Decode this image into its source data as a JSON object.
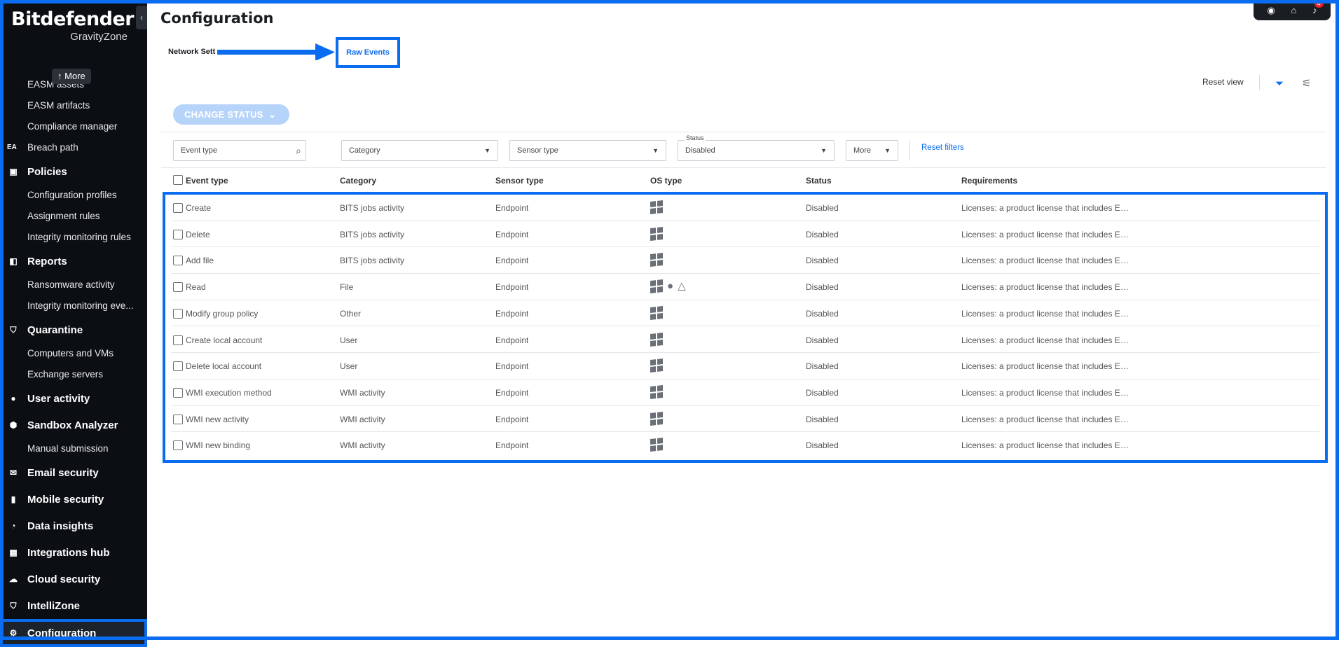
{
  "brand": {
    "name": "Bitdefender",
    "sub": "GravityZone"
  },
  "sidebar": {
    "more_label": "↑ More",
    "items": [
      {
        "kind": "sub",
        "label": "EASM assets",
        "name": "nav-easm-assets"
      },
      {
        "kind": "sub",
        "label": "EASM artifacts",
        "name": "nav-easm-artifacts"
      },
      {
        "kind": "sub",
        "label": "Compliance manager",
        "name": "nav-compliance-manager"
      },
      {
        "kind": "ea",
        "label": "Breach path",
        "icon": "EA",
        "name": "nav-breach-path"
      },
      {
        "kind": "sec",
        "label": "Policies",
        "icon": "▣",
        "name": "nav-policies"
      },
      {
        "kind": "sub",
        "label": "Configuration profiles",
        "name": "nav-configuration-profiles"
      },
      {
        "kind": "sub",
        "label": "Assignment rules",
        "name": "nav-assignment-rules"
      },
      {
        "kind": "sub",
        "label": "Integrity monitoring rules",
        "name": "nav-integrity-monitoring-rules"
      },
      {
        "kind": "sec",
        "label": "Reports",
        "icon": "◧",
        "name": "nav-reports"
      },
      {
        "kind": "sub",
        "label": "Ransomware activity",
        "name": "nav-ransomware-activity"
      },
      {
        "kind": "sub",
        "label": "Integrity monitoring eve...",
        "name": "nav-integrity-monitoring-events"
      },
      {
        "kind": "sec",
        "label": "Quarantine",
        "icon": "⛉",
        "name": "nav-quarantine"
      },
      {
        "kind": "sub",
        "label": "Computers and VMs",
        "name": "nav-computers-and-vms"
      },
      {
        "kind": "sub",
        "label": "Exchange servers",
        "name": "nav-exchange-servers"
      },
      {
        "kind": "sec",
        "label": "User activity",
        "icon": "●",
        "name": "nav-user-activity"
      },
      {
        "kind": "sec",
        "label": "Sandbox Analyzer",
        "icon": "⬢",
        "name": "nav-sandbox-analyzer"
      },
      {
        "kind": "sub",
        "label": "Manual submission",
        "name": "nav-manual-submission"
      },
      {
        "kind": "sec",
        "label": "Email security",
        "icon": "✉",
        "name": "nav-email-security"
      },
      {
        "kind": "sec",
        "label": "Mobile security",
        "icon": "▮",
        "name": "nav-mobile-security"
      },
      {
        "kind": "sec",
        "label": "Data insights",
        "icon": "◔",
        "name": "nav-data-insights"
      },
      {
        "kind": "sec",
        "label": "Integrations hub",
        "icon": "▦",
        "name": "nav-integrations-hub"
      },
      {
        "kind": "sec",
        "label": "Cloud security",
        "icon": "☁",
        "name": "nav-cloud-security"
      },
      {
        "kind": "sec",
        "label": "IntelliZone",
        "icon": "⛉",
        "name": "nav-intellizone"
      },
      {
        "kind": "sec",
        "label": "Configuration",
        "icon": "⚙",
        "name": "nav-configuration",
        "active": true
      }
    ]
  },
  "header": {
    "title": "Configuration",
    "notification_count": "4"
  },
  "tabs": {
    "network": "Network Sett",
    "raw_events": "Raw Events"
  },
  "toolbar": {
    "reset_view": "Reset view",
    "change_status": "CHANGE STATUS"
  },
  "filters": {
    "event_type_placeholder": "Event type",
    "category": "Category",
    "sensor_type": "Sensor type",
    "status_label": "Status",
    "status_value": "Disabled",
    "more": "More",
    "reset_filters": "Reset filters"
  },
  "table": {
    "columns": [
      "Event type",
      "Category",
      "Sensor type",
      "OS type",
      "Status",
      "Requirements"
    ],
    "rows": [
      {
        "event": "Create",
        "category": "BITS jobs activity",
        "sensor": "Endpoint",
        "os": [
          "windows"
        ],
        "status": "Disabled",
        "req": "Licenses: a product license that includes ED..."
      },
      {
        "event": "Delete",
        "category": "BITS jobs activity",
        "sensor": "Endpoint",
        "os": [
          "windows"
        ],
        "status": "Disabled",
        "req": "Licenses: a product license that includes ED..."
      },
      {
        "event": "Add file",
        "category": "BITS jobs activity",
        "sensor": "Endpoint",
        "os": [
          "windows"
        ],
        "status": "Disabled",
        "req": "Licenses: a product license that includes ED..."
      },
      {
        "event": "Read",
        "category": "File",
        "sensor": "Endpoint",
        "os": [
          "windows",
          "apple",
          "linux"
        ],
        "status": "Disabled",
        "req": "Licenses: a product license that includes ED..."
      },
      {
        "event": "Modify group policy",
        "category": "Other",
        "sensor": "Endpoint",
        "os": [
          "windows"
        ],
        "status": "Disabled",
        "req": "Licenses: a product license that includes ED..."
      },
      {
        "event": "Create local account",
        "category": "User",
        "sensor": "Endpoint",
        "os": [
          "windows"
        ],
        "status": "Disabled",
        "req": "Licenses: a product license that includes ED..."
      },
      {
        "event": "Delete local account",
        "category": "User",
        "sensor": "Endpoint",
        "os": [
          "windows"
        ],
        "status": "Disabled",
        "req": "Licenses: a product license that includes ED..."
      },
      {
        "event": "WMI execution method",
        "category": "WMI activity",
        "sensor": "Endpoint",
        "os": [
          "windows"
        ],
        "status": "Disabled",
        "req": "Licenses: a product license that includes ED..."
      },
      {
        "event": "WMI new activity",
        "category": "WMI activity",
        "sensor": "Endpoint",
        "os": [
          "windows"
        ],
        "status": "Disabled",
        "req": "Licenses: a product license that includes ED..."
      },
      {
        "event": "WMI new binding",
        "category": "WMI activity",
        "sensor": "Endpoint",
        "os": [
          "windows"
        ],
        "status": "Disabled",
        "req": "Licenses: a product license that includes ED..."
      }
    ]
  },
  "colors": {
    "accent": "#0a6cf0",
    "sidebar_bg": "#0b0e13"
  }
}
